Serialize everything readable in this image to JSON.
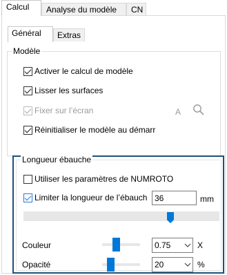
{
  "main_tabs": [
    {
      "label": "Calcul",
      "active": true
    },
    {
      "label": "Analyse du modèle",
      "active": false
    },
    {
      "label": "CN",
      "active": false
    }
  ],
  "sub_tabs": [
    {
      "label": "Général",
      "active": true
    },
    {
      "label": "Extras",
      "active": false
    }
  ],
  "modele": {
    "title": "Modèle",
    "activer": {
      "label": "Activer le calcul de modèle",
      "checked": true
    },
    "lisser": {
      "label": "Lisser les surfaces",
      "checked": true
    },
    "fixer": {
      "label": "Fixer sur l’écran",
      "checked": true,
      "disabled": true
    },
    "fixer_letter": "A",
    "reinit": {
      "label": "Réinitialiser le modèle au démarr",
      "checked": true
    }
  },
  "longueur": {
    "title": "Longueur ébauche",
    "numroto": {
      "label": "Utiliser les paramètres de NUMROTO",
      "checked": false
    },
    "limiter": {
      "label": "Limiter la longueur de l’ébauch",
      "checked": true
    },
    "length_value": "36",
    "length_unit": "mm",
    "length_slider_level": 0.75,
    "couleur": {
      "label": "Couleur",
      "value": "0.75",
      "unit": "X",
      "slider_level": 0.37
    },
    "opacite": {
      "label": "Opacité",
      "value": "20",
      "unit": "%",
      "slider_level": 0.22
    }
  },
  "colors": {
    "accent": "#0078d7",
    "focus_border": "#1e4f78"
  },
  "icons": {
    "search": "search-icon",
    "dropdown": "chevron-down-icon",
    "check": "check-icon"
  }
}
